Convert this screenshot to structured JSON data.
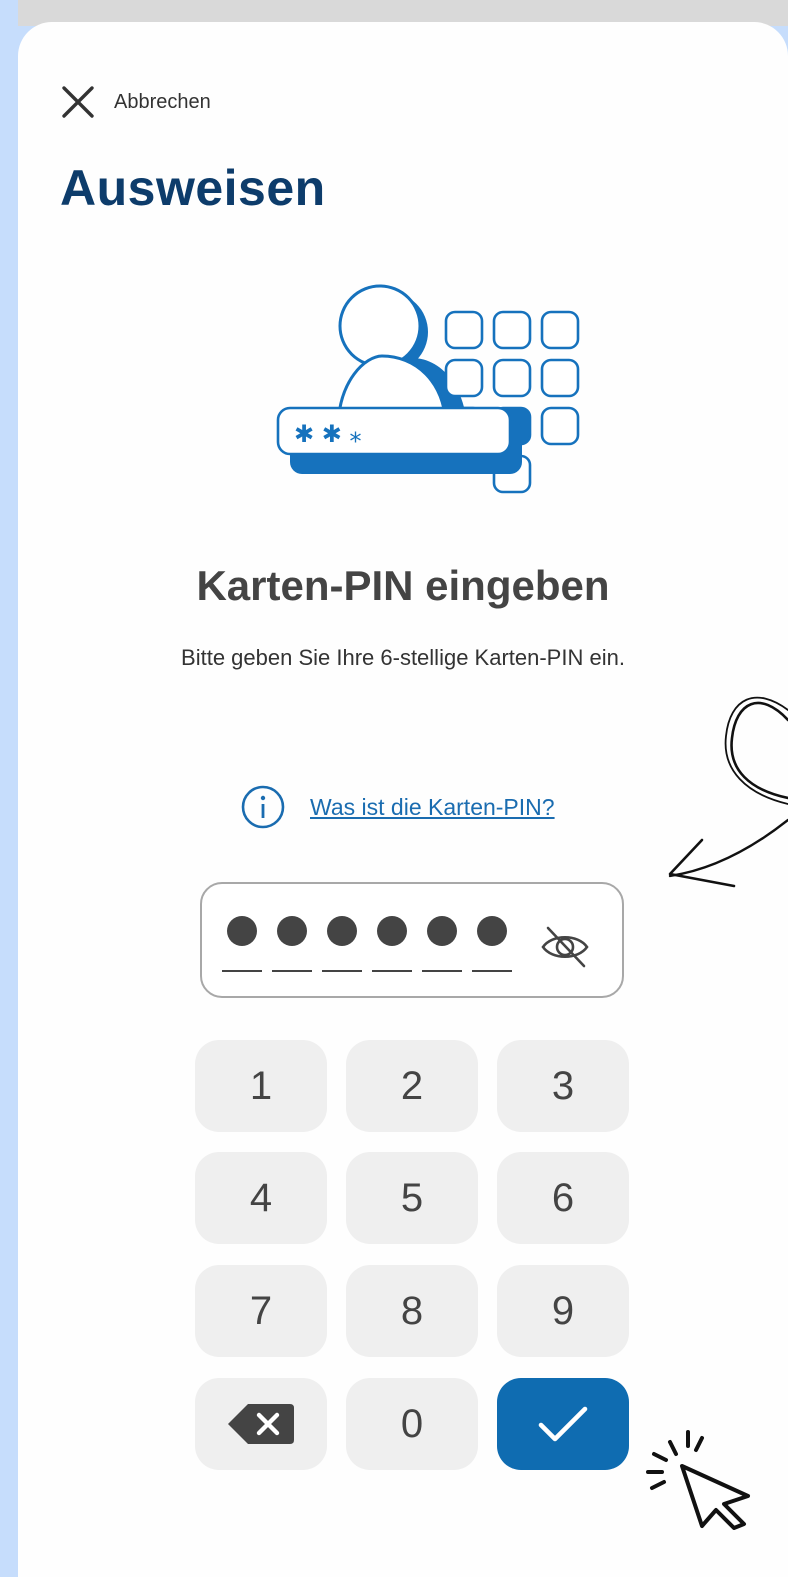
{
  "header": {
    "cancel_label": "Abbrechen",
    "title": "Ausweisen"
  },
  "illustration": {
    "icon": "person-pin-keypad-illustration",
    "pin_stars": "✱ ✱ ⁎"
  },
  "pin_entry": {
    "heading": "Karten-PIN eingeben",
    "subtitle": "Bitte geben Sie Ihre 6-stellige Karten-PIN ein.",
    "info_link": "Was ist die Karten-PIN?",
    "digits_entered": 6,
    "digits_total": 6,
    "visibility_icon": "eye-off-icon"
  },
  "keypad": {
    "keys": [
      "1",
      "2",
      "3",
      "4",
      "5",
      "6",
      "7",
      "8",
      "9"
    ],
    "zero": "0",
    "backspace_icon": "backspace-icon",
    "confirm_icon": "check-icon"
  },
  "colors": {
    "background": "#c6ddfc",
    "accent": "#0f6cb1",
    "title": "#0d3c6b",
    "key_bg": "#efefef"
  }
}
